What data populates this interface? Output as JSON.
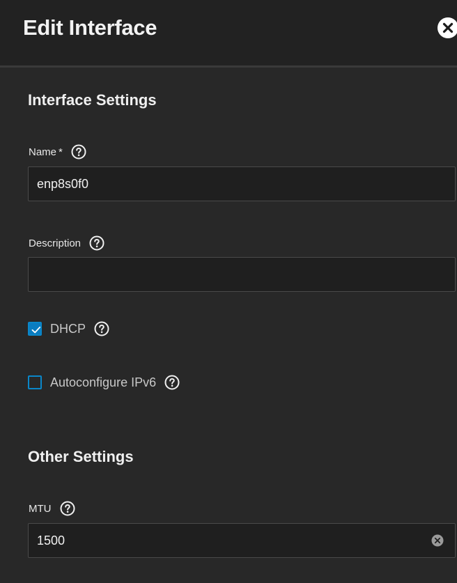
{
  "header": {
    "title": "Edit Interface"
  },
  "interface_settings": {
    "section_title": "Interface Settings",
    "name": {
      "label": "Name",
      "required_marker": "*",
      "value": "enp8s0f0"
    },
    "description": {
      "label": "Description",
      "value": ""
    },
    "dhcp": {
      "label": "DHCP",
      "checked": true
    },
    "autoconfigure_ipv6": {
      "label": "Autoconfigure IPv6",
      "checked": false
    }
  },
  "other_settings": {
    "section_title": "Other Settings",
    "mtu": {
      "label": "MTU",
      "value": "1500"
    }
  },
  "colors": {
    "accent": "#0a7cc0",
    "background": "#282828",
    "header": "#222222"
  },
  "icons": {
    "close": "close-icon",
    "help": "help-circle-icon",
    "check": "check-icon",
    "clear": "clear-circle-icon"
  }
}
